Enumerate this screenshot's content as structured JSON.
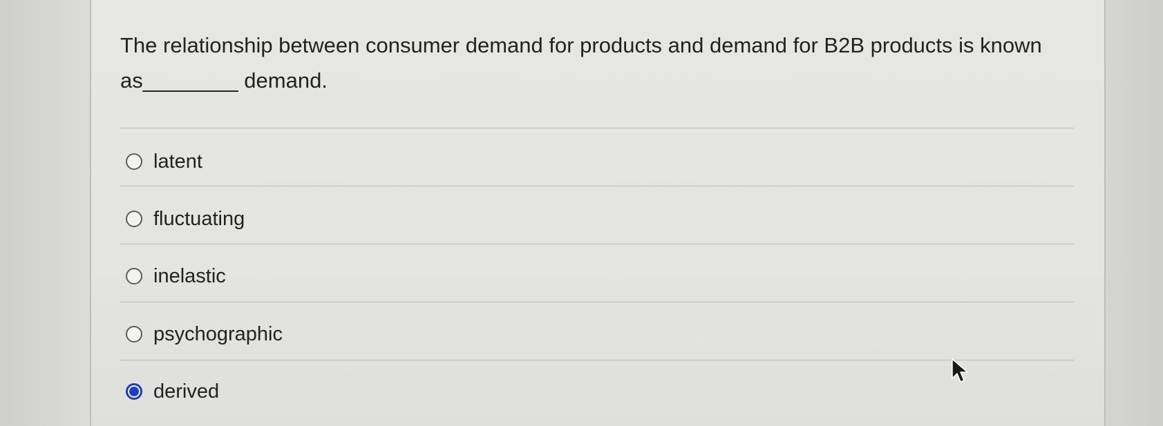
{
  "question": {
    "text": "The relationship between consumer demand for products and demand for B2B products is known as________ demand."
  },
  "options": [
    {
      "label": "latent",
      "selected": false
    },
    {
      "label": "fluctuating",
      "selected": false
    },
    {
      "label": "inelastic",
      "selected": false
    },
    {
      "label": "psychographic",
      "selected": false
    },
    {
      "label": "derived",
      "selected": true
    }
  ],
  "colors": {
    "selected_radio": "#1c3fc6",
    "text": "#222222",
    "background": "#e4e4e1"
  },
  "icons": {
    "pointer": "mouse-cursor-icon"
  }
}
